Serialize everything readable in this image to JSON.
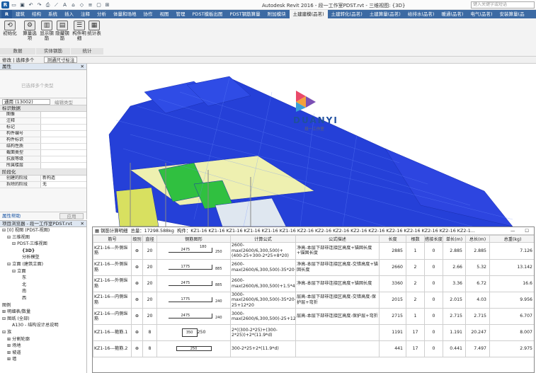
{
  "app": {
    "window_title": "Autodesk Revit 2016 -  段一工作室PDST.rvt - 三维视图: {3D}",
    "search_placeholder": "键入关键字或短语"
  },
  "ribbon": {
    "tabs": [
      "R",
      "建筑",
      "结构",
      "系统",
      "插入",
      "注释",
      "分析",
      "体量和场地",
      "协作",
      "视图",
      "管理",
      "PDST模板出图",
      "PDST钢筋算量",
      "附加模块",
      "土建建模(品茗)",
      "土建转化(品茗)",
      "土建算量(品茗)",
      "给排水(品茗)",
      "暖通(品茗)",
      "电气(品茗)",
      "安装算量(品"
    ],
    "buttons": [
      {
        "label": "初始化",
        "icon": "init-icon"
      },
      {
        "label": "算量选项",
        "icon": "gear-icon"
      },
      {
        "label": "显示钢筋",
        "icon": "show-rebar-icon"
      },
      {
        "label": "隐藏钢筋",
        "icon": "hide-rebar-icon"
      },
      {
        "label": "构件明细",
        "icon": "component-list-icon"
      },
      {
        "label": "统计表",
        "icon": "stats-table-icon"
      }
    ],
    "groups": [
      "数据",
      "实体钢筋",
      "统计"
    ]
  },
  "context_bar": {
    "modify": "修改 | 选择多个",
    "filter": "测通尺寸标注"
  },
  "properties": {
    "title": "属性",
    "type_name": "已选择多个类型",
    "type_select": "通用 (13002)",
    "edit_type": "编辑类型",
    "sections": [
      {
        "name": "标识数据",
        "rows": [
          {
            "k": "图像",
            "v": ""
          },
          {
            "k": "注释",
            "v": ""
          },
          {
            "k": "标记",
            "v": ""
          },
          {
            "k": "构件编号",
            "v": ""
          },
          {
            "k": "构件标识",
            "v": ""
          },
          {
            "k": "结构性质",
            "v": ""
          },
          {
            "k": "截面类型",
            "v": ""
          },
          {
            "k": "抗震等级",
            "v": ""
          },
          {
            "k": "所属楼层",
            "v": ""
          }
        ]
      },
      {
        "name": "阶段化",
        "rows": [
          {
            "k": "创建的阶段",
            "v": "新构造"
          },
          {
            "k": "拆除的阶段",
            "v": "无"
          }
        ]
      }
    ],
    "help": "属性帮助",
    "apply": "应用"
  },
  "project_browser": {
    "title": "项目浏览器 - 段一工作室PDST.rvt",
    "rows": [
      {
        "t": "⊟ [0] 视图 (PDST-视图)",
        "indent": 0
      },
      {
        "t": "⊟ 三维视图",
        "indent": 1
      },
      {
        "t": "⊟ PDST-三维视图",
        "indent": 2
      },
      {
        "t": "{3D}",
        "indent": 4,
        "bold": true
      },
      {
        "t": "分析模型",
        "indent": 4
      },
      {
        "t": "⊟ 立面 (建筑立面)",
        "indent": 1
      },
      {
        "t": "⊟ 立面",
        "indent": 2
      },
      {
        "t": "东",
        "indent": 4
      },
      {
        "t": "北",
        "indent": 4
      },
      {
        "t": "南",
        "indent": 4
      },
      {
        "t": "西",
        "indent": 4
      },
      {
        "t": "图例",
        "indent": 0
      },
      {
        "t": "⊞ 明细表/数量",
        "indent": 0
      },
      {
        "t": "⊟ 图纸 (全部)",
        "indent": 0
      },
      {
        "t": "A130 - 结构设计总说明",
        "indent": 2
      },
      {
        "t": "⊟ 族",
        "indent": 0
      },
      {
        "t": "⊞ 分割轮廓",
        "indent": 1
      },
      {
        "t": "⊞ 场地",
        "indent": 1
      },
      {
        "t": "⊞ 坡道",
        "indent": 1
      },
      {
        "t": "⊞ 墙",
        "indent": 1
      }
    ]
  },
  "logo": {
    "text": "DUANYI",
    "sub": "段一工作室"
  },
  "rebar_dialog": {
    "title_prefix": "钢筋计算明细",
    "total_weight": "总量：17298.588kg",
    "components": "构件：KZ1-16 KZ1-16 KZ1-16 KZ1-16 KZ1-16 KZ1-16 KZ2-16 KZ2-16 KZ2-16 KZ2-16 KZ2-16 KZ2-16 KZ2-16 KZ2-16 KZ2-16 KZ2-1...",
    "columns": [
      "筋号",
      "级别",
      "直径",
      "钢筋图形",
      "计算公式",
      "公式描述",
      "长度",
      "根数",
      "搭接长度",
      "单长(m)",
      "总长(m)",
      "总重(kg)"
    ],
    "rows": [
      {
        "id": "KZ1-16---外侧纵筋",
        "grade": "⊕",
        "dia": "20",
        "shape": {
          "kind": "bar",
          "left": "2475",
          "right": "250",
          "top": "180"
        },
        "formula": "2600-max(2600/6,300,500)+(400-25+300-2*25+8*20)",
        "desc": "净高-本层下部非连接区高度+锚固长度+锚固长度",
        "length": "2885",
        "count": "1",
        "lap": "0",
        "unit_len": "2.885",
        "total_len": "2.885",
        "weight": "7.126"
      },
      {
        "id": "KZ1-16---外侧纵筋",
        "grade": "⊕",
        "dia": "20",
        "shape": {
          "kind": "bar",
          "left": "1775",
          "right": "885",
          "top": ""
        },
        "formula": "2600-max(2600/6,300,500)-35*20+1.5*42*20",
        "desc": "净高-本层下部非连接区高度-交错高度+锚固长度",
        "length": "2660",
        "count": "2",
        "lap": "0",
        "unit_len": "2.66",
        "total_len": "5.32",
        "weight": "13.142"
      },
      {
        "id": "KZ1-16---外侧纵筋",
        "grade": "⊕",
        "dia": "20",
        "shape": {
          "kind": "bar",
          "left": "2475",
          "right": "885",
          "top": ""
        },
        "formula": "2600-max(2600/6,300,500)+1.5*42*20",
        "desc": "净高-本层下部非连接区高度+锚固长度",
        "length": "3360",
        "count": "2",
        "lap": "0",
        "unit_len": "3.36",
        "total_len": "6.72",
        "weight": "16.6"
      },
      {
        "id": "KZ1-16---内侧纵筋",
        "grade": "⊕",
        "dia": "20",
        "shape": {
          "kind": "bar",
          "left": "1775",
          "right": "240",
          "top": ""
        },
        "formula": "3000-max(2600/6,300,500)-35*20-25+12*20",
        "desc": "层高-本层下部非连接区高度-交错高度-保护层+弯折",
        "length": "2015",
        "count": "2",
        "lap": "0",
        "unit_len": "2.015",
        "total_len": "4.03",
        "weight": "9.956"
      },
      {
        "id": "KZ1-16---内侧纵筋",
        "grade": "⊕",
        "dia": "20",
        "shape": {
          "kind": "bar",
          "left": "2475",
          "right": "240",
          "top": ""
        },
        "formula": "3000-max(2600/6,300,500)-25+12*20",
        "desc": "层高-本层下部非连接区高度-保护层+弯折",
        "length": "2715",
        "count": "1",
        "lap": "0",
        "unit_len": "2.715",
        "total_len": "2.715",
        "weight": "6.707"
      },
      {
        "id": "KZ1-16---箍筋.1",
        "grade": "⊕",
        "dia": "8",
        "shape": {
          "kind": "stirrup",
          "left": "350",
          "right": "250",
          "top": ""
        },
        "formula": "2*((300-2*25)+(300-2*25))+2*(11.9*d)",
        "desc": "",
        "length": "1191",
        "count": "17",
        "lap": "0",
        "unit_len": "1.191",
        "total_len": "20.247",
        "weight": "8.007"
      },
      {
        "id": "KZ1-16---箍筋.2",
        "grade": "⊕",
        "dia": "8",
        "shape": {
          "kind": "stirrup2",
          "left": "250",
          "right": "",
          "top": ""
        },
        "formula": "300-2*25+2*(11.9*d)",
        "desc": "",
        "length": "441",
        "count": "17",
        "lap": "0",
        "unit_len": "0.441",
        "total_len": "7.497",
        "weight": "2.975"
      }
    ]
  }
}
